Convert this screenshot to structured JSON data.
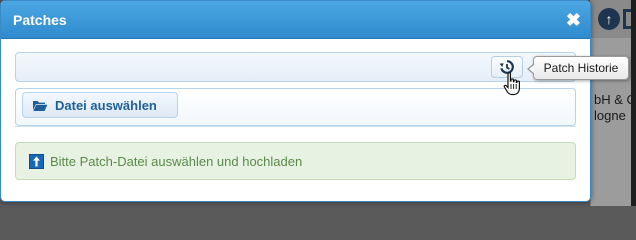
{
  "dialog": {
    "title": "Patches",
    "close_glyph": "✖"
  },
  "toolbar": {
    "history_icon": "history-icon",
    "tooltip": "Patch Historie"
  },
  "file": {
    "button_label": "Datei auswählen",
    "icon": "folder-open-icon"
  },
  "info": {
    "message": "Bitte Patch-Datei auswählen und hochladen",
    "icon": "upload-icon"
  },
  "background": {
    "text_line_1": "bH & C",
    "text_line_2": "logne"
  },
  "colors": {
    "titlebar": "#3399db",
    "accent": "#1f5f99",
    "info_text": "#5a8a4a",
    "info_bg": "#e8f2e2"
  }
}
